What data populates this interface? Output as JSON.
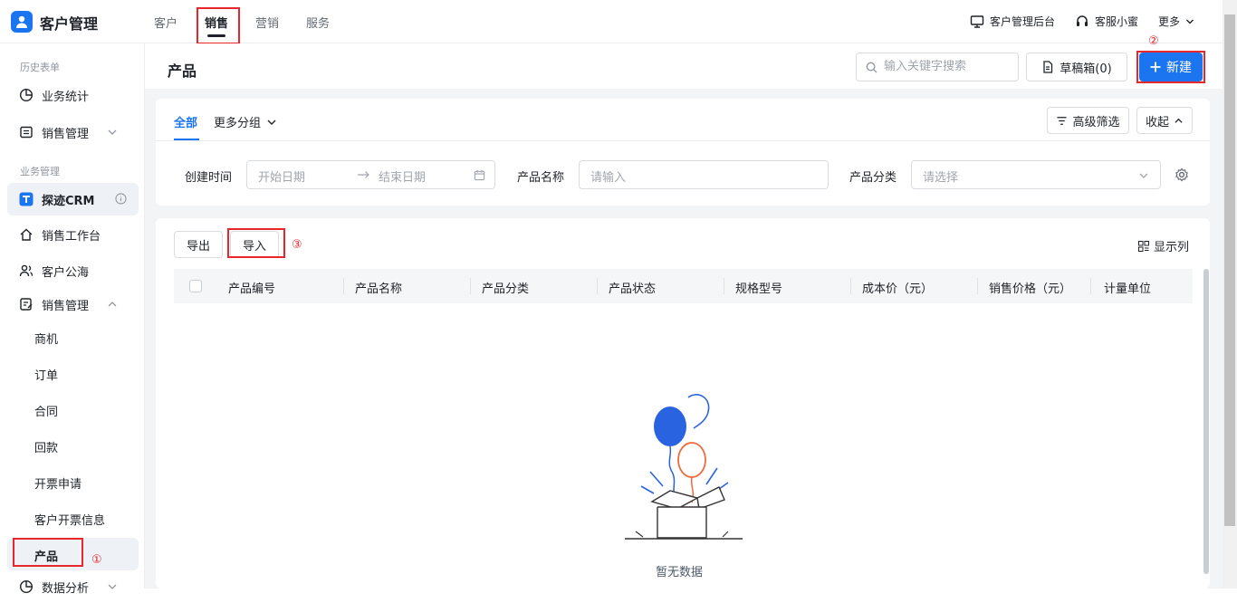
{
  "app": {
    "title": "客户管理"
  },
  "topnav": {
    "items": [
      "客户",
      "销售",
      "营销",
      "服务"
    ],
    "active": "销售"
  },
  "topright": {
    "admin": "客户管理后台",
    "support": "客服小蜜",
    "more": "更多"
  },
  "sidebar": {
    "history_group": "历史表单",
    "history_items": [
      "业务统计",
      "销售管理"
    ],
    "business_group": "业务管理",
    "business_items": [
      "探迹CRM",
      "销售工作台",
      "客户公海",
      "销售管理"
    ],
    "sales_sub_items": [
      "商机",
      "订单",
      "合同",
      "回款",
      "开票申请",
      "客户开票信息",
      "产品"
    ],
    "bottom_item": "数据分析",
    "active": "产品"
  },
  "page": {
    "title": "产品",
    "search_placeholder": "输入关键字搜索",
    "draft_label": "草稿箱(0)",
    "new_label": "新建"
  },
  "filters": {
    "tabs": [
      "全部",
      "更多分组"
    ],
    "advanced": "高级筛选",
    "collapse": "收起",
    "created_time_label": "创建时间",
    "start_date": "开始日期",
    "end_date": "结束日期",
    "product_name_label": "产品名称",
    "product_name_placeholder": "请输入",
    "category_label": "产品分类",
    "category_placeholder": "请选择"
  },
  "table": {
    "export": "导出",
    "import": "导入",
    "show_columns": "显示列",
    "columns": [
      "产品编号",
      "产品名称",
      "产品分类",
      "产品状态",
      "规格型号",
      "成本价（元）",
      "销售价格（元）",
      "计量单位"
    ],
    "rows": [],
    "empty_text": "暂无数据"
  },
  "annotations": {
    "one": "①",
    "two": "②",
    "three": "③"
  },
  "colors": {
    "accent": "#1c75f0",
    "highlight": "#e8262b",
    "balloon_blue": "#2a63e0",
    "balloon_orange": "#f06b3a"
  }
}
